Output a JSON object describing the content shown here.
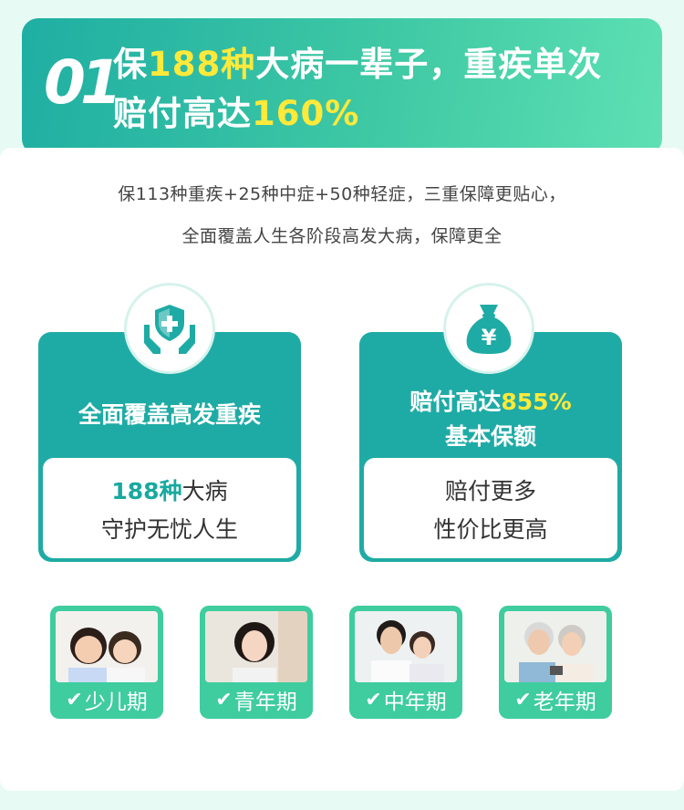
{
  "header": {
    "number": "01",
    "line1_a": "保",
    "line1_hl": "188种",
    "line1_b": "大病一辈子，重疾单次",
    "line2_a": "赔付高达",
    "line2_hl": "160%"
  },
  "intro": {
    "line1": "保113种重疾+25种中症+50种轻症，三重保障更贴心，",
    "line2": "全面覆盖人生各阶段高发大病，保障更全"
  },
  "features": [
    {
      "icon": "shield-hands-icon",
      "title": "全面覆盖高发重疾",
      "body_hl": "188种",
      "body_a": "大病",
      "body_b": "守护无忧人生"
    },
    {
      "icon": "money-bag-yen-icon",
      "title_a": "赔付高达",
      "title_hl": "855%",
      "title_b": "基本保额",
      "body_a": "赔付更多",
      "body_b": "性价比更高"
    }
  ],
  "stages": [
    {
      "label": "少儿期",
      "photo": "children-photo"
    },
    {
      "label": "青年期",
      "photo": "young-woman-photo"
    },
    {
      "label": "中年期",
      "photo": "middle-aged-couple-photo"
    },
    {
      "label": "老年期",
      "photo": "elderly-couple-photo"
    }
  ],
  "colors": {
    "accent_teal": "#1faba5",
    "accent_green": "#3fcc9e",
    "highlight_yellow": "#ffe93a",
    "background": "#e7faf4"
  }
}
